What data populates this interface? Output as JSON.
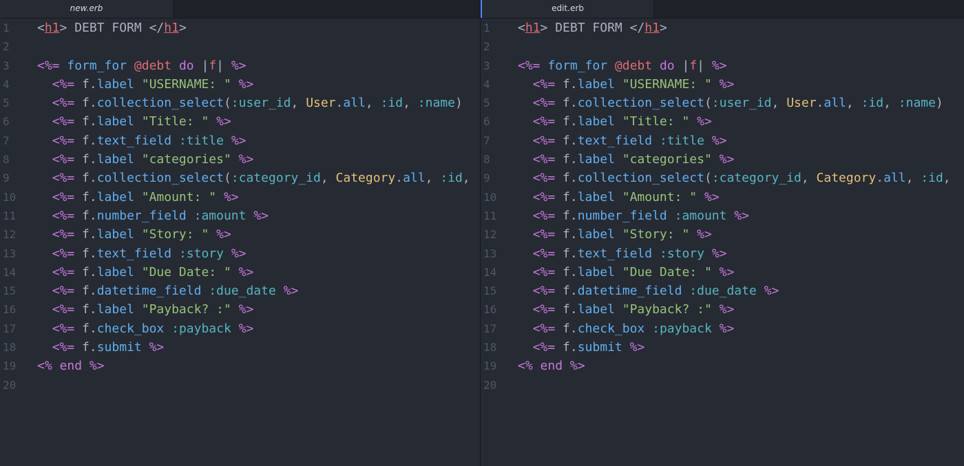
{
  "tabs": {
    "left": "new.erb",
    "right": "edit.erb"
  },
  "line_numbers": [
    "1",
    "2",
    "3",
    "4",
    "5",
    "6",
    "7",
    "8",
    "9",
    "10",
    "11",
    "12",
    "13",
    "14",
    "15",
    "16",
    "17",
    "18",
    "19",
    "20"
  ],
  "code_lines": [
    [
      [
        "tk-punc",
        "<"
      ],
      [
        "tk-tag",
        "h1"
      ],
      [
        "tk-punc",
        "> DEBT FORM </"
      ],
      [
        "tk-tag",
        "h1"
      ],
      [
        "tk-punc",
        ">"
      ]
    ],
    [],
    [
      [
        "tk-erb",
        "<%="
      ],
      [
        "tk-plain",
        " "
      ],
      [
        "tk-fn",
        "form_for"
      ],
      [
        "tk-plain",
        " "
      ],
      [
        "tk-ivar",
        "@debt"
      ],
      [
        "tk-plain",
        " "
      ],
      [
        "tk-kw",
        "do"
      ],
      [
        "tk-plain",
        " |"
      ],
      [
        "tk-ivar",
        "f"
      ],
      [
        "tk-plain",
        "| "
      ],
      [
        "tk-erb",
        "%>"
      ]
    ],
    [
      [
        "tk-plain",
        "  "
      ],
      [
        "tk-erb",
        "<%="
      ],
      [
        "tk-plain",
        " f."
      ],
      [
        "tk-fn",
        "label"
      ],
      [
        "tk-plain",
        " "
      ],
      [
        "tk-str",
        "\"USERNAME: \""
      ],
      [
        "tk-plain",
        " "
      ],
      [
        "tk-erb",
        "%>"
      ]
    ],
    [
      [
        "tk-plain",
        "  "
      ],
      [
        "tk-erb",
        "<%="
      ],
      [
        "tk-plain",
        " f."
      ],
      [
        "tk-fn",
        "collection_select"
      ],
      [
        "tk-plain",
        "("
      ],
      [
        "tk-sym",
        ":user_id"
      ],
      [
        "tk-plain",
        ", "
      ],
      [
        "tk-const",
        "User"
      ],
      [
        "tk-plain",
        "."
      ],
      [
        "tk-fn",
        "all"
      ],
      [
        "tk-plain",
        ", "
      ],
      [
        "tk-sym",
        ":id"
      ],
      [
        "tk-plain",
        ", "
      ],
      [
        "tk-sym",
        ":name"
      ],
      [
        "tk-plain",
        ")"
      ]
    ],
    [
      [
        "tk-plain",
        "  "
      ],
      [
        "tk-erb",
        "<%="
      ],
      [
        "tk-plain",
        " f."
      ],
      [
        "tk-fn",
        "label"
      ],
      [
        "tk-plain",
        " "
      ],
      [
        "tk-str",
        "\"Title: \""
      ],
      [
        "tk-plain",
        " "
      ],
      [
        "tk-erb",
        "%>"
      ]
    ],
    [
      [
        "tk-plain",
        "  "
      ],
      [
        "tk-erb",
        "<%="
      ],
      [
        "tk-plain",
        " f."
      ],
      [
        "tk-fn",
        "text_field"
      ],
      [
        "tk-plain",
        " "
      ],
      [
        "tk-sym",
        ":title"
      ],
      [
        "tk-plain",
        " "
      ],
      [
        "tk-erb",
        "%>"
      ]
    ],
    [
      [
        "tk-plain",
        "  "
      ],
      [
        "tk-erb",
        "<%="
      ],
      [
        "tk-plain",
        " f."
      ],
      [
        "tk-fn",
        "label"
      ],
      [
        "tk-plain",
        " "
      ],
      [
        "tk-str",
        "\"categories\""
      ],
      [
        "tk-plain",
        " "
      ],
      [
        "tk-erb",
        "%>"
      ]
    ],
    [
      [
        "tk-plain",
        "  "
      ],
      [
        "tk-erb",
        "<%="
      ],
      [
        "tk-plain",
        " f."
      ],
      [
        "tk-fn",
        "collection_select"
      ],
      [
        "tk-plain",
        "("
      ],
      [
        "tk-sym",
        ":category_id"
      ],
      [
        "tk-plain",
        ", "
      ],
      [
        "tk-const",
        "Category"
      ],
      [
        "tk-plain",
        "."
      ],
      [
        "tk-fn",
        "all"
      ],
      [
        "tk-plain",
        ", "
      ],
      [
        "tk-sym",
        ":id"
      ],
      [
        "tk-plain",
        ","
      ]
    ],
    [
      [
        "tk-plain",
        "  "
      ],
      [
        "tk-erb",
        "<%="
      ],
      [
        "tk-plain",
        " f."
      ],
      [
        "tk-fn",
        "label"
      ],
      [
        "tk-plain",
        " "
      ],
      [
        "tk-str",
        "\"Amount: \""
      ],
      [
        "tk-plain",
        " "
      ],
      [
        "tk-erb",
        "%>"
      ]
    ],
    [
      [
        "tk-plain",
        "  "
      ],
      [
        "tk-erb",
        "<%="
      ],
      [
        "tk-plain",
        " f."
      ],
      [
        "tk-fn",
        "number_field"
      ],
      [
        "tk-plain",
        " "
      ],
      [
        "tk-sym",
        ":amount"
      ],
      [
        "tk-plain",
        " "
      ],
      [
        "tk-erb",
        "%>"
      ]
    ],
    [
      [
        "tk-plain",
        "  "
      ],
      [
        "tk-erb",
        "<%="
      ],
      [
        "tk-plain",
        " f."
      ],
      [
        "tk-fn",
        "label"
      ],
      [
        "tk-plain",
        " "
      ],
      [
        "tk-str",
        "\"Story: \""
      ],
      [
        "tk-plain",
        " "
      ],
      [
        "tk-erb",
        "%>"
      ]
    ],
    [
      [
        "tk-plain",
        "  "
      ],
      [
        "tk-erb",
        "<%="
      ],
      [
        "tk-plain",
        " f."
      ],
      [
        "tk-fn",
        "text_field"
      ],
      [
        "tk-plain",
        " "
      ],
      [
        "tk-sym",
        ":story"
      ],
      [
        "tk-plain",
        " "
      ],
      [
        "tk-erb",
        "%>"
      ]
    ],
    [
      [
        "tk-plain",
        "  "
      ],
      [
        "tk-erb",
        "<%="
      ],
      [
        "tk-plain",
        " f."
      ],
      [
        "tk-fn",
        "label"
      ],
      [
        "tk-plain",
        " "
      ],
      [
        "tk-str",
        "\"Due Date: \""
      ],
      [
        "tk-plain",
        " "
      ],
      [
        "tk-erb",
        "%>"
      ]
    ],
    [
      [
        "tk-plain",
        "  "
      ],
      [
        "tk-erb",
        "<%="
      ],
      [
        "tk-plain",
        " f."
      ],
      [
        "tk-fn",
        "datetime_field"
      ],
      [
        "tk-plain",
        " "
      ],
      [
        "tk-sym",
        ":due_date"
      ],
      [
        "tk-plain",
        " "
      ],
      [
        "tk-erb",
        "%>"
      ]
    ],
    [
      [
        "tk-plain",
        "  "
      ],
      [
        "tk-erb",
        "<%="
      ],
      [
        "tk-plain",
        " f."
      ],
      [
        "tk-fn",
        "label"
      ],
      [
        "tk-plain",
        " "
      ],
      [
        "tk-str",
        "\"Payback? :\""
      ],
      [
        "tk-plain",
        " "
      ],
      [
        "tk-erb",
        "%>"
      ]
    ],
    [
      [
        "tk-plain",
        "  "
      ],
      [
        "tk-erb",
        "<%="
      ],
      [
        "tk-plain",
        " f."
      ],
      [
        "tk-fn",
        "check_box"
      ],
      [
        "tk-plain",
        " "
      ],
      [
        "tk-sym",
        ":payback"
      ],
      [
        "tk-plain",
        " "
      ],
      [
        "tk-erb",
        "%>"
      ]
    ],
    [
      [
        "tk-plain",
        "  "
      ],
      [
        "tk-erb",
        "<%="
      ],
      [
        "tk-plain",
        " f."
      ],
      [
        "tk-fn",
        "submit"
      ],
      [
        "tk-plain",
        " "
      ],
      [
        "tk-erb",
        "%>"
      ]
    ],
    [
      [
        "tk-erb",
        "<%"
      ],
      [
        "tk-plain",
        " "
      ],
      [
        "tk-kw",
        "end"
      ],
      [
        "tk-plain",
        " "
      ],
      [
        "tk-erb",
        "%>"
      ]
    ],
    []
  ],
  "colors": {
    "background": "#262a33",
    "tab_bar": "#1e2127",
    "gutter": "#4f5666",
    "erb_tag": "#c678dd",
    "html_tag": "#e06c75",
    "method": "#61afef",
    "string": "#98c379",
    "symbol": "#56b6c2",
    "constant": "#e5c07b",
    "instance_var": "#e06c75",
    "plain": "#abb2bf"
  }
}
